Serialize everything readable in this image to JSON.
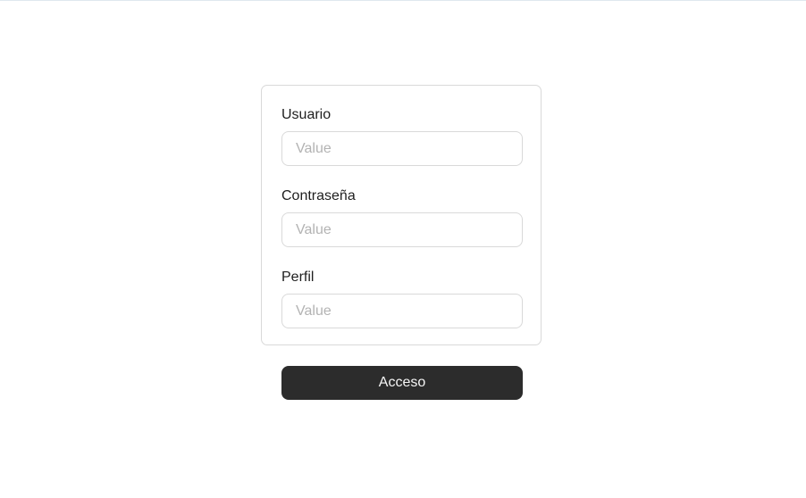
{
  "form": {
    "fields": [
      {
        "label": "Usuario",
        "placeholder": "Value",
        "value": ""
      },
      {
        "label": "Contraseña",
        "placeholder": "Value",
        "value": ""
      },
      {
        "label": "Perfil",
        "placeholder": "Value",
        "value": ""
      }
    ],
    "submit_label": "Acceso"
  },
  "colors": {
    "button_background": "#2c2c2c",
    "button_text": "#f5f5f5",
    "border": "#d9d9d9",
    "placeholder": "#b3b3b3",
    "label_text": "#1e1e1e"
  }
}
